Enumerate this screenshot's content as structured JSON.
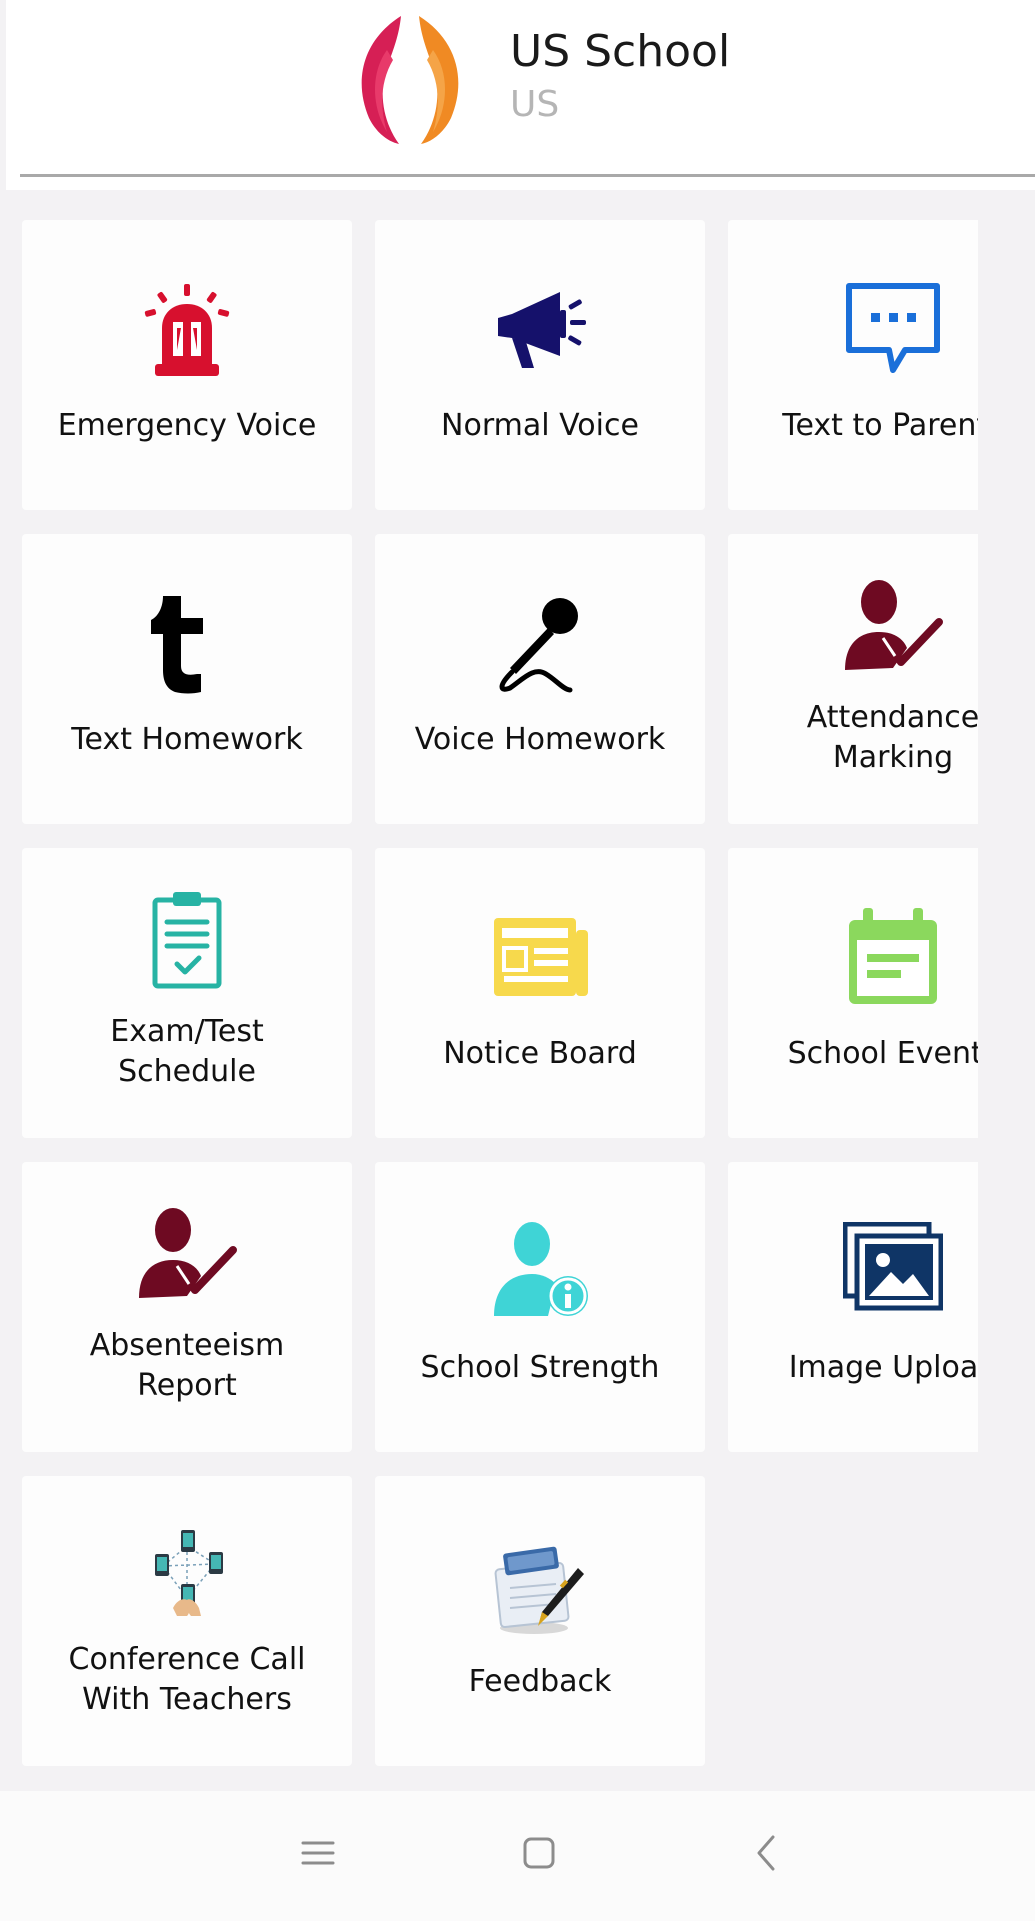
{
  "header": {
    "title": "US School",
    "subtitle": "US"
  },
  "tiles": [
    {
      "label": "Emergency Voice",
      "icon": "siren-icon",
      "color": "#d7102e"
    },
    {
      "label": "Normal Voice",
      "icon": "megaphone-icon",
      "color": "#15116b"
    },
    {
      "label": "Text to Parents",
      "icon": "chat-bubble-icon",
      "color": "#1a6fd9"
    },
    {
      "label": "Text Homework",
      "icon": "letter-t-icon",
      "color": "#000000"
    },
    {
      "label": "Voice Homework",
      "icon": "microphone-icon",
      "color": "#000000"
    },
    {
      "label": "Attendance Marking",
      "line1": "Attendance",
      "line2": "Marking",
      "icon": "user-check-icon",
      "color": "#6e0a22"
    },
    {
      "label": "Exam/Test Schedule",
      "line1": "Exam/Test",
      "line2": "Schedule",
      "icon": "clipboard-check-icon",
      "color": "#27b3a4"
    },
    {
      "label": "Notice Board",
      "icon": "newspaper-icon",
      "color": "#f7d94c"
    },
    {
      "label": "School Events",
      "icon": "calendar-icon",
      "color": "#8bd85d"
    },
    {
      "label": "Absenteeism Report",
      "line1": "Absenteeism",
      "line2": "Report",
      "icon": "user-check-icon",
      "color": "#6e0a22"
    },
    {
      "label": "School Strength",
      "icon": "user-info-icon",
      "color": "#3fd4d6"
    },
    {
      "label": "Image Upload",
      "icon": "image-gallery-icon",
      "color": "#0f3566"
    },
    {
      "label": "Conference Call With Teachers",
      "line1": "Conference Call",
      "line2": "With Teachers",
      "icon": "phones-network-icon",
      "color": "#2f8f8f"
    },
    {
      "label": "Feedback",
      "icon": "feedback-pen-icon",
      "color": "#3a6aa8"
    }
  ],
  "navbar": {
    "items": [
      "menu-icon",
      "home-square-icon",
      "back-chevron-icon"
    ]
  }
}
